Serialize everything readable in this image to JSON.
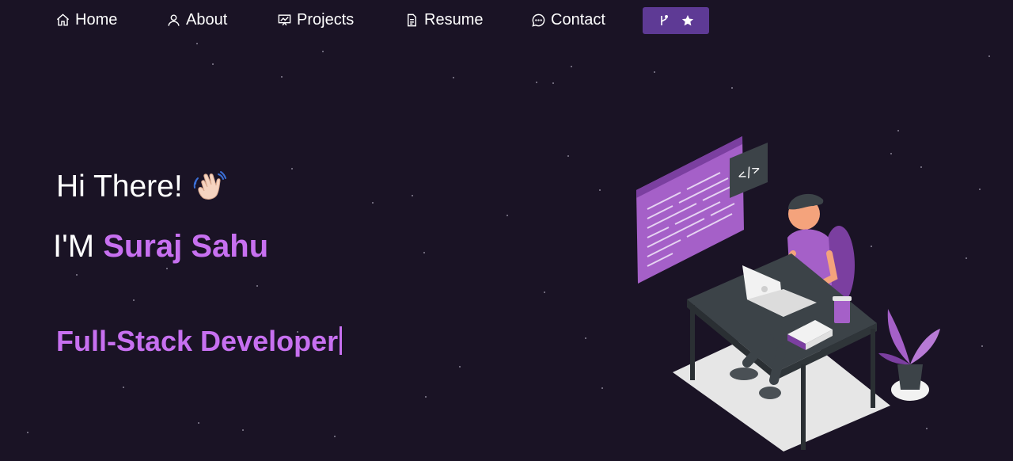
{
  "nav": {
    "items": [
      {
        "label": "Home",
        "icon": "home-icon"
      },
      {
        "label": "About",
        "icon": "user-icon"
      },
      {
        "label": "Projects",
        "icon": "presentation-icon"
      },
      {
        "label": "Resume",
        "icon": "document-icon"
      },
      {
        "label": "Contact",
        "icon": "chat-icon"
      }
    ],
    "github_button": {
      "icons": [
        "git-fork-icon",
        "star-icon"
      ],
      "color": "#5e3a95"
    }
  },
  "hero": {
    "greeting": "Hi There!",
    "greeting_emoji": "waving-hand-icon",
    "intro_prefix": "I'M ",
    "name": "Suraj Sahu",
    "role": "Full-Stack Developer"
  },
  "colors": {
    "background": "#1a1325",
    "accent": "#c770f0",
    "button": "#5e3a95"
  }
}
